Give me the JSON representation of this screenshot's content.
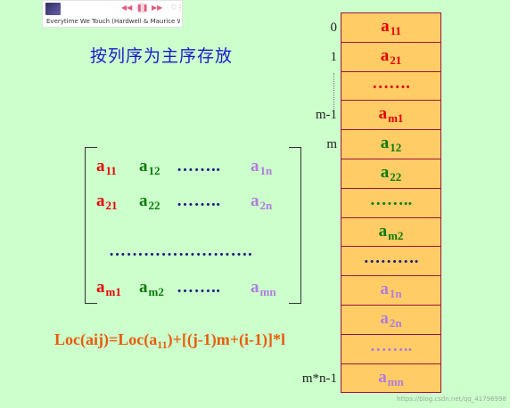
{
  "player": {
    "song_title": "Everytime We Touch (Hardwell & Maurice We...",
    "icons": [
      "album-art",
      "previous-icon",
      "pause-icon",
      "next-icon",
      "heart-icon",
      "menu-icon"
    ]
  },
  "heading": "按列序为主序存放",
  "matrix": {
    "rows": [
      {
        "cells": [
          {
            "base": "a",
            "sub": "11",
            "color": "#e60000"
          },
          {
            "base": "a",
            "sub": "12",
            "color": "#0a7a0a"
          },
          {
            "dots": "……..",
            "color": "#1a1a80"
          },
          {
            "base": "a",
            "sub": "1n",
            "color": "#b07ddc"
          }
        ]
      },
      {
        "cells": [
          {
            "base": "a",
            "sub": "21",
            "color": "#e60000"
          },
          {
            "base": "a",
            "sub": "22",
            "color": "#0a7a0a"
          },
          {
            "dots": "……..",
            "color": "#1a1a80"
          },
          {
            "base": "a",
            "sub": "2n",
            "color": "#b07ddc"
          }
        ]
      },
      {
        "dots_row": "……………………."
      },
      {
        "cells": [
          {
            "base": "a",
            "sub": "m1",
            "color": "#e60000"
          },
          {
            "base": "a",
            "sub": "m2",
            "color": "#0a7a0a"
          },
          {
            "dots": "……..",
            "color": "#1a1a80"
          },
          {
            "base": "a",
            "sub": "mn",
            "color": "#b07ddc"
          }
        ]
      }
    ]
  },
  "formula": {
    "part1": "Loc(aij)=Loc(a",
    "sub": "11",
    "part2": ")+[(j-1)m+(i-1)]*l"
  },
  "storage": {
    "slots": [
      {
        "base": "a",
        "sub": "11",
        "color": "#e60000",
        "address": "0"
      },
      {
        "base": "a",
        "sub": "21",
        "color": "#e60000",
        "address": "1"
      },
      {
        "dots": "…….",
        "color": "#e60000",
        "address": ""
      },
      {
        "base": "a",
        "sub": "m1",
        "color": "#e60000",
        "address": "m-1"
      },
      {
        "base": "a",
        "sub": "12",
        "color": "#0a7a0a",
        "address": "m"
      },
      {
        "base": "a",
        "sub": "22",
        "color": "#0a7a0a",
        "address": ""
      },
      {
        "dots": "……..",
        "color": "#0a7a0a",
        "address": ""
      },
      {
        "base": "a",
        "sub": "m2",
        "color": "#0a7a0a",
        "address": ""
      },
      {
        "dots": "……….",
        "color": "#1a1a80",
        "address": ""
      },
      {
        "base": "a",
        "sub": "1n",
        "color": "#b07ddc",
        "address": ""
      },
      {
        "base": "a",
        "sub": "2n",
        "color": "#b07ddc",
        "address": ""
      },
      {
        "dots": "……..",
        "color": "#b07ddc",
        "address": ""
      },
      {
        "base": "a",
        "sub": "mn",
        "color": "#b07ddc",
        "address": "m*n-1"
      }
    ]
  },
  "watermark": "https://blog.csdn.net/qq_41796998"
}
